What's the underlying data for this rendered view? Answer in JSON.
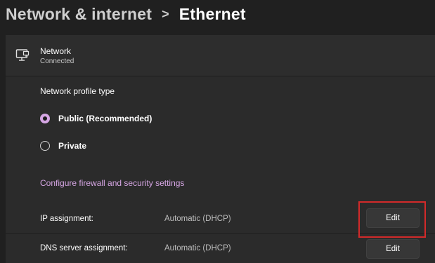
{
  "breadcrumb": {
    "parent": "Network & internet",
    "separator": ">",
    "current": "Ethernet"
  },
  "network": {
    "icon": "ethernet-monitor-icon",
    "title": "Network",
    "status": "Connected"
  },
  "profile": {
    "label": "Network profile type",
    "options": [
      {
        "label": "Public (Recommended)",
        "selected": true
      },
      {
        "label": "Private",
        "selected": false
      }
    ]
  },
  "firewall_link": "Configure firewall and security settings",
  "settings": [
    {
      "label": "IP assignment:",
      "value": "Automatic (DHCP)",
      "button": "Edit",
      "highlighted": true
    },
    {
      "label": "DNS server assignment:",
      "value": "Automatic (DHCP)",
      "button": "Edit",
      "highlighted": false
    }
  ],
  "colors": {
    "background": "#202020",
    "card": "#2b2b2b",
    "accent": "#d6a6e4",
    "highlight": "#d22a2a"
  }
}
